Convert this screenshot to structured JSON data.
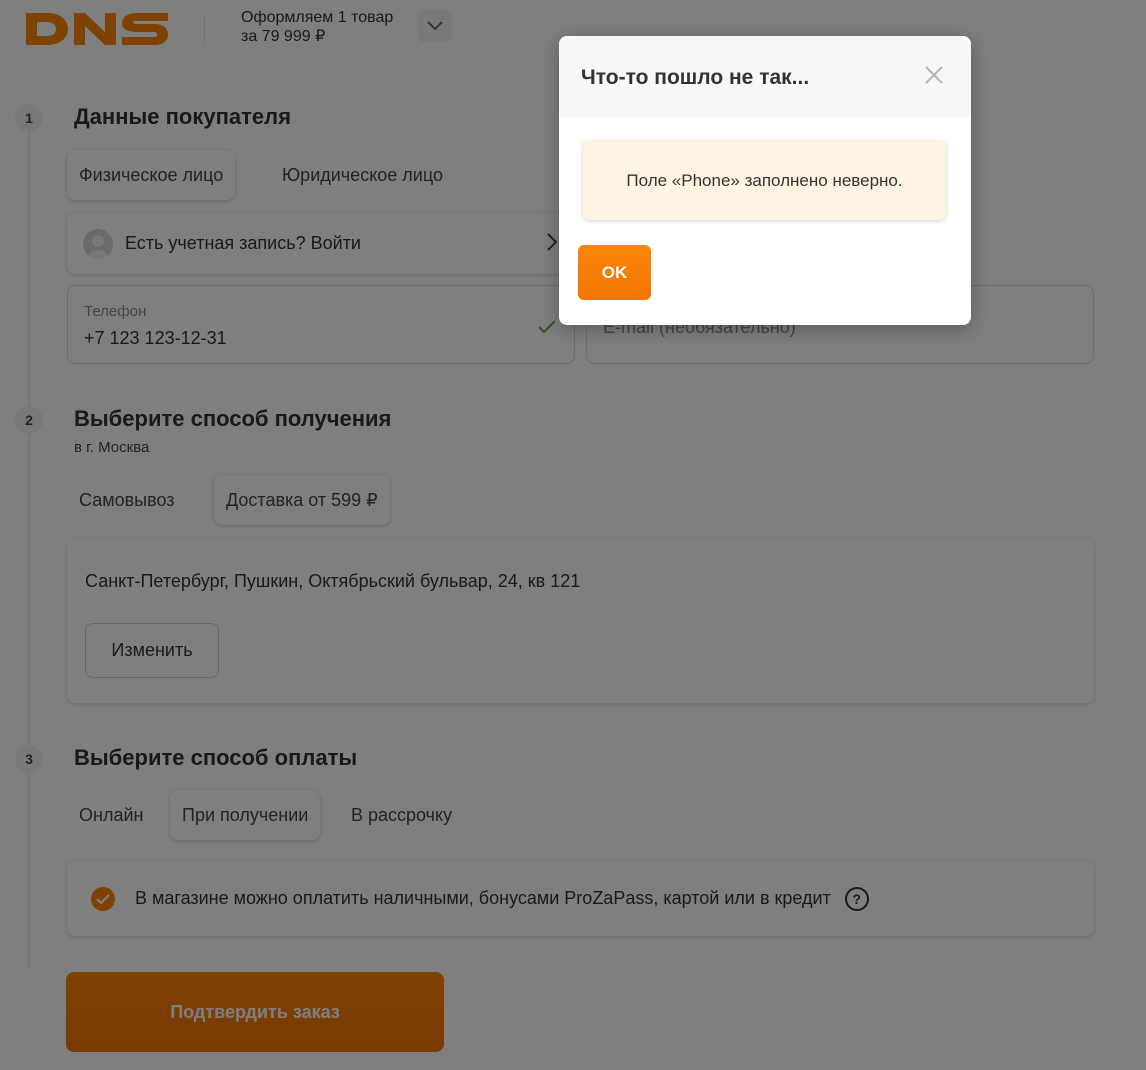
{
  "brand": {
    "logo_text": "DNS",
    "accent": "#fc8507"
  },
  "header": {
    "order_line1": "Оформляем 1 товар",
    "order_line2": "за 79 999 ₽",
    "toggle_icon": "chevron-down-icon"
  },
  "step1": {
    "number": "1",
    "title": "Данные покупателя",
    "tabs": [
      {
        "label": "Физическое лицо",
        "active": true
      },
      {
        "label": "Юридическое лицо",
        "active": false
      }
    ],
    "login_text": "Есть учетная запись? Войти",
    "phone": {
      "label": "Телефон",
      "value": "+7 123 123-12-31"
    },
    "email": {
      "placeholder": "E-mail (необязательно)"
    }
  },
  "step2": {
    "number": "2",
    "title": "Выберите способ получения",
    "city": "в г. Москва",
    "tabs": [
      {
        "label": "Самовывоз",
        "active": false
      },
      {
        "label": "Доставка от 599 ₽",
        "active": true
      }
    ],
    "address": "Санкт-Петербург, Пушкин, Октябрьский бульвар, 24, кв 121",
    "change_label": "Изменить"
  },
  "step3": {
    "number": "3",
    "title": "Выберите способ оплаты",
    "tabs": [
      {
        "label": "Онлайн",
        "active": false
      },
      {
        "label": "При получении",
        "active": true
      },
      {
        "label": "В рассрочку",
        "active": false
      }
    ],
    "payment_note": "В магазине можно оплатить наличными, бонусами ProZaPass, картой или в кредит",
    "help_glyph": "?"
  },
  "confirm_label": "Подтвердить заказ",
  "modal": {
    "title": "Что-то пошло не так...",
    "message": "Поле «Phone» заполнено неверно.",
    "ok_label": "OK"
  }
}
